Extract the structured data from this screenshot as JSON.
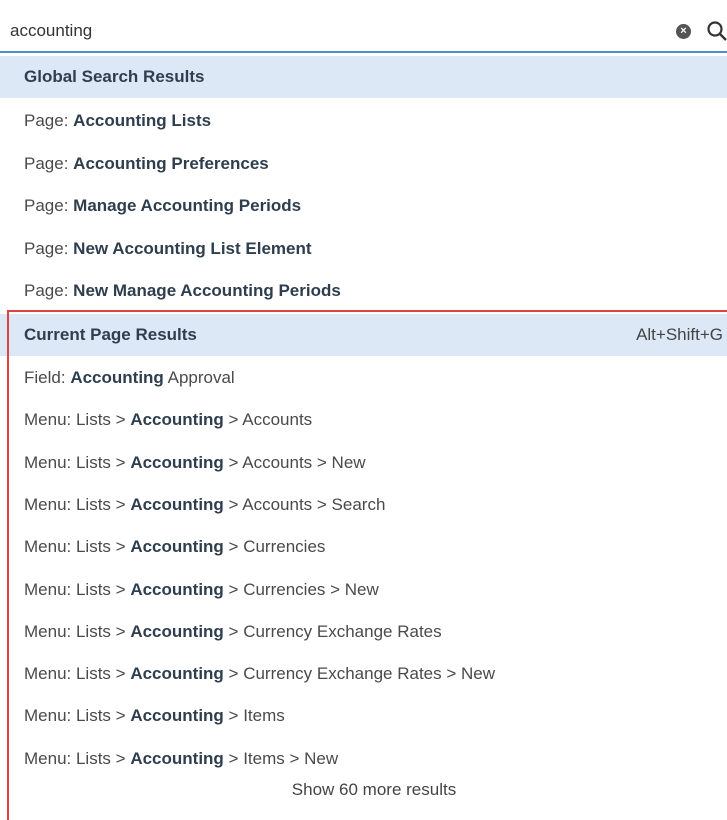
{
  "search": {
    "value": "accounting"
  },
  "global": {
    "header": "Global Search Results",
    "items": [
      {
        "prefix": "Page:",
        "bold": "Accounting Lists",
        "rest": ""
      },
      {
        "prefix": "Page:",
        "bold": "Accounting Preferences",
        "rest": ""
      },
      {
        "prefix": "Page:",
        "bold": "Manage Accounting Periods",
        "rest": ""
      },
      {
        "prefix": "Page:",
        "bold": "New Accounting List Element",
        "rest": ""
      },
      {
        "prefix": "Page:",
        "bold": "New Manage Accounting Periods",
        "rest": ""
      }
    ]
  },
  "current": {
    "header": "Current Page Results",
    "shortcut": "Alt+Shift+G",
    "items": [
      {
        "prefix": "Field:",
        "bold": "Accounting",
        "rest": "Approval"
      },
      {
        "prefix": "Menu: Lists >",
        "bold": "Accounting",
        "rest": "> Accounts"
      },
      {
        "prefix": "Menu: Lists >",
        "bold": "Accounting",
        "rest": "> Accounts > New"
      },
      {
        "prefix": "Menu: Lists >",
        "bold": "Accounting",
        "rest": "> Accounts > Search"
      },
      {
        "prefix": "Menu: Lists >",
        "bold": "Accounting",
        "rest": "> Currencies"
      },
      {
        "prefix": "Menu: Lists >",
        "bold": "Accounting",
        "rest": "> Currencies > New"
      },
      {
        "prefix": "Menu: Lists >",
        "bold": "Accounting",
        "rest": "> Currency Exchange Rates"
      },
      {
        "prefix": "Menu: Lists >",
        "bold": "Accounting",
        "rest": "> Currency Exchange Rates > New"
      },
      {
        "prefix": "Menu: Lists >",
        "bold": "Accounting",
        "rest": "> Items"
      },
      {
        "prefix": "Menu: Lists >",
        "bold": "Accounting",
        "rest": "> Items > New"
      }
    ]
  },
  "show_more": "Show 60 more results",
  "icons": {
    "clear": "clear-icon",
    "search": "search-icon"
  },
  "colors": {
    "accent": "#4a8dd6",
    "header_bg": "#dde8f6",
    "highlight_frame": "#e04141"
  }
}
